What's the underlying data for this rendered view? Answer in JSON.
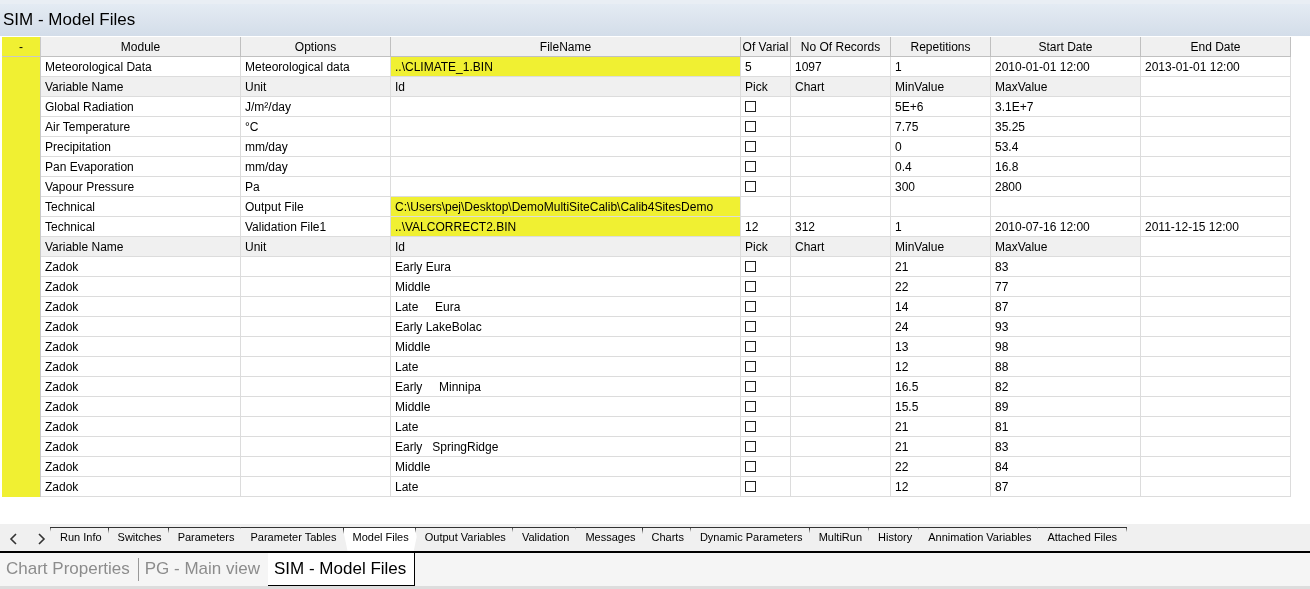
{
  "title": "SIM - Model Files",
  "collapse_label": "-",
  "columns": [
    "Module",
    "Options",
    "FileName",
    "Of Varial",
    "No Of Records",
    "Repetitions",
    "Start Date",
    "End Date"
  ],
  "rows": [
    {
      "kind": "file",
      "module": "Meteorological Data",
      "option": "Meteorological data",
      "file": "..\\CLIMATE_1.BIN",
      "variables": "5",
      "records": "1097",
      "repetitions": "1",
      "start": "2010-01-01 12:00",
      "end": "2013-01-01 12:00"
    },
    {
      "kind": "subheader",
      "cells": [
        "Variable Name",
        "Unit",
        "Id",
        "Pick",
        "Chart",
        "MinValue",
        "MaxValue"
      ]
    },
    {
      "kind": "variable",
      "name": "Global Radiation",
      "unit": "J/m²/day",
      "checked": false,
      "min": "5E+6",
      "max": "3.1E+7"
    },
    {
      "kind": "variable",
      "name": "Air Temperature",
      "unit": "°C",
      "checked": false,
      "min": "7.75",
      "max": "35.25"
    },
    {
      "kind": "variable",
      "name": "Precipitation",
      "unit": "mm/day",
      "checked": false,
      "min": "0",
      "max": "53.4"
    },
    {
      "kind": "variable",
      "name": "Pan Evaporation",
      "unit": "mm/day",
      "checked": false,
      "min": "0.4",
      "max": "16.8"
    },
    {
      "kind": "variable",
      "name": "Vapour Pressure",
      "unit": "Pa",
      "checked": false,
      "min": "300",
      "max": "2800"
    },
    {
      "kind": "file",
      "module": "Technical",
      "option": "Output File",
      "file": "C:\\Users\\pej\\Desktop\\DemoMultiSiteCalib\\Calib4SitesDemo"
    },
    {
      "kind": "file",
      "module": "Technical",
      "option": "Validation File1",
      "file": "..\\VALCORRECT2.BIN",
      "variables": "12",
      "records": "312",
      "repetitions": "1",
      "start": "2010-07-16 12:00",
      "end": "2011-12-15 12:00"
    },
    {
      "kind": "subheader",
      "cells": [
        "Variable Name",
        "Unit",
        "Id",
        "Pick",
        "Chart",
        "MinValue",
        "MaxValue"
      ]
    },
    {
      "kind": "variable",
      "name": "Zadok",
      "id": "Early Eura",
      "checked": false,
      "min": "21",
      "max": "83"
    },
    {
      "kind": "variable",
      "name": "Zadok",
      "id": "Middle",
      "checked": false,
      "min": "22",
      "max": "77"
    },
    {
      "kind": "variable",
      "name": "Zadok",
      "id": "Late     Eura",
      "checked": false,
      "min": "14",
      "max": "87"
    },
    {
      "kind": "variable",
      "name": "Zadok",
      "id": "Early LakeBolac",
      "checked": false,
      "min": "24",
      "max": "93"
    },
    {
      "kind": "variable",
      "name": "Zadok",
      "id": "Middle",
      "checked": false,
      "min": "13",
      "max": "98"
    },
    {
      "kind": "variable",
      "name": "Zadok",
      "id": "Late",
      "checked": false,
      "min": "12",
      "max": "88"
    },
    {
      "kind": "variable",
      "name": "Zadok",
      "id": "Early     Minnipa",
      "checked": false,
      "min": "16.5",
      "max": "82"
    },
    {
      "kind": "variable",
      "name": "Zadok",
      "id": "Middle",
      "checked": false,
      "min": "15.5",
      "max": "89"
    },
    {
      "kind": "variable",
      "name": "Zadok",
      "id": "Late",
      "checked": false,
      "min": "21",
      "max": "81"
    },
    {
      "kind": "variable",
      "name": "Zadok",
      "id": "Early   SpringRidge",
      "checked": false,
      "min": "21",
      "max": "83"
    },
    {
      "kind": "variable",
      "name": "Zadok",
      "id": "Middle",
      "checked": false,
      "min": "22",
      "max": "84"
    },
    {
      "kind": "variable",
      "name": "Zadok",
      "id": "Late",
      "checked": false,
      "min": "12",
      "max": "87"
    }
  ],
  "sheet_tabs": [
    {
      "label": "Run Info",
      "selected": false
    },
    {
      "label": "Switches",
      "selected": false
    },
    {
      "label": "Parameters",
      "selected": false
    },
    {
      "label": "Parameter Tables",
      "selected": false
    },
    {
      "label": "Model Files",
      "selected": true
    },
    {
      "label": "Output Variables",
      "selected": false
    },
    {
      "label": "Validation",
      "selected": false
    },
    {
      "label": "Messages",
      "selected": false
    },
    {
      "label": "Charts",
      "selected": false
    },
    {
      "label": "Dynamic Parameters",
      "selected": false
    },
    {
      "label": "MultiRun",
      "selected": false
    },
    {
      "label": "History",
      "selected": false
    },
    {
      "label": "Annimation Variables",
      "selected": false
    },
    {
      "label": "Attached Files",
      "selected": false
    }
  ],
  "doc_tabs": [
    {
      "label": "Chart Properties",
      "selected": false
    },
    {
      "label": "PG - Main view",
      "selected": false
    },
    {
      "label": "SIM - Model Files",
      "selected": true
    }
  ]
}
